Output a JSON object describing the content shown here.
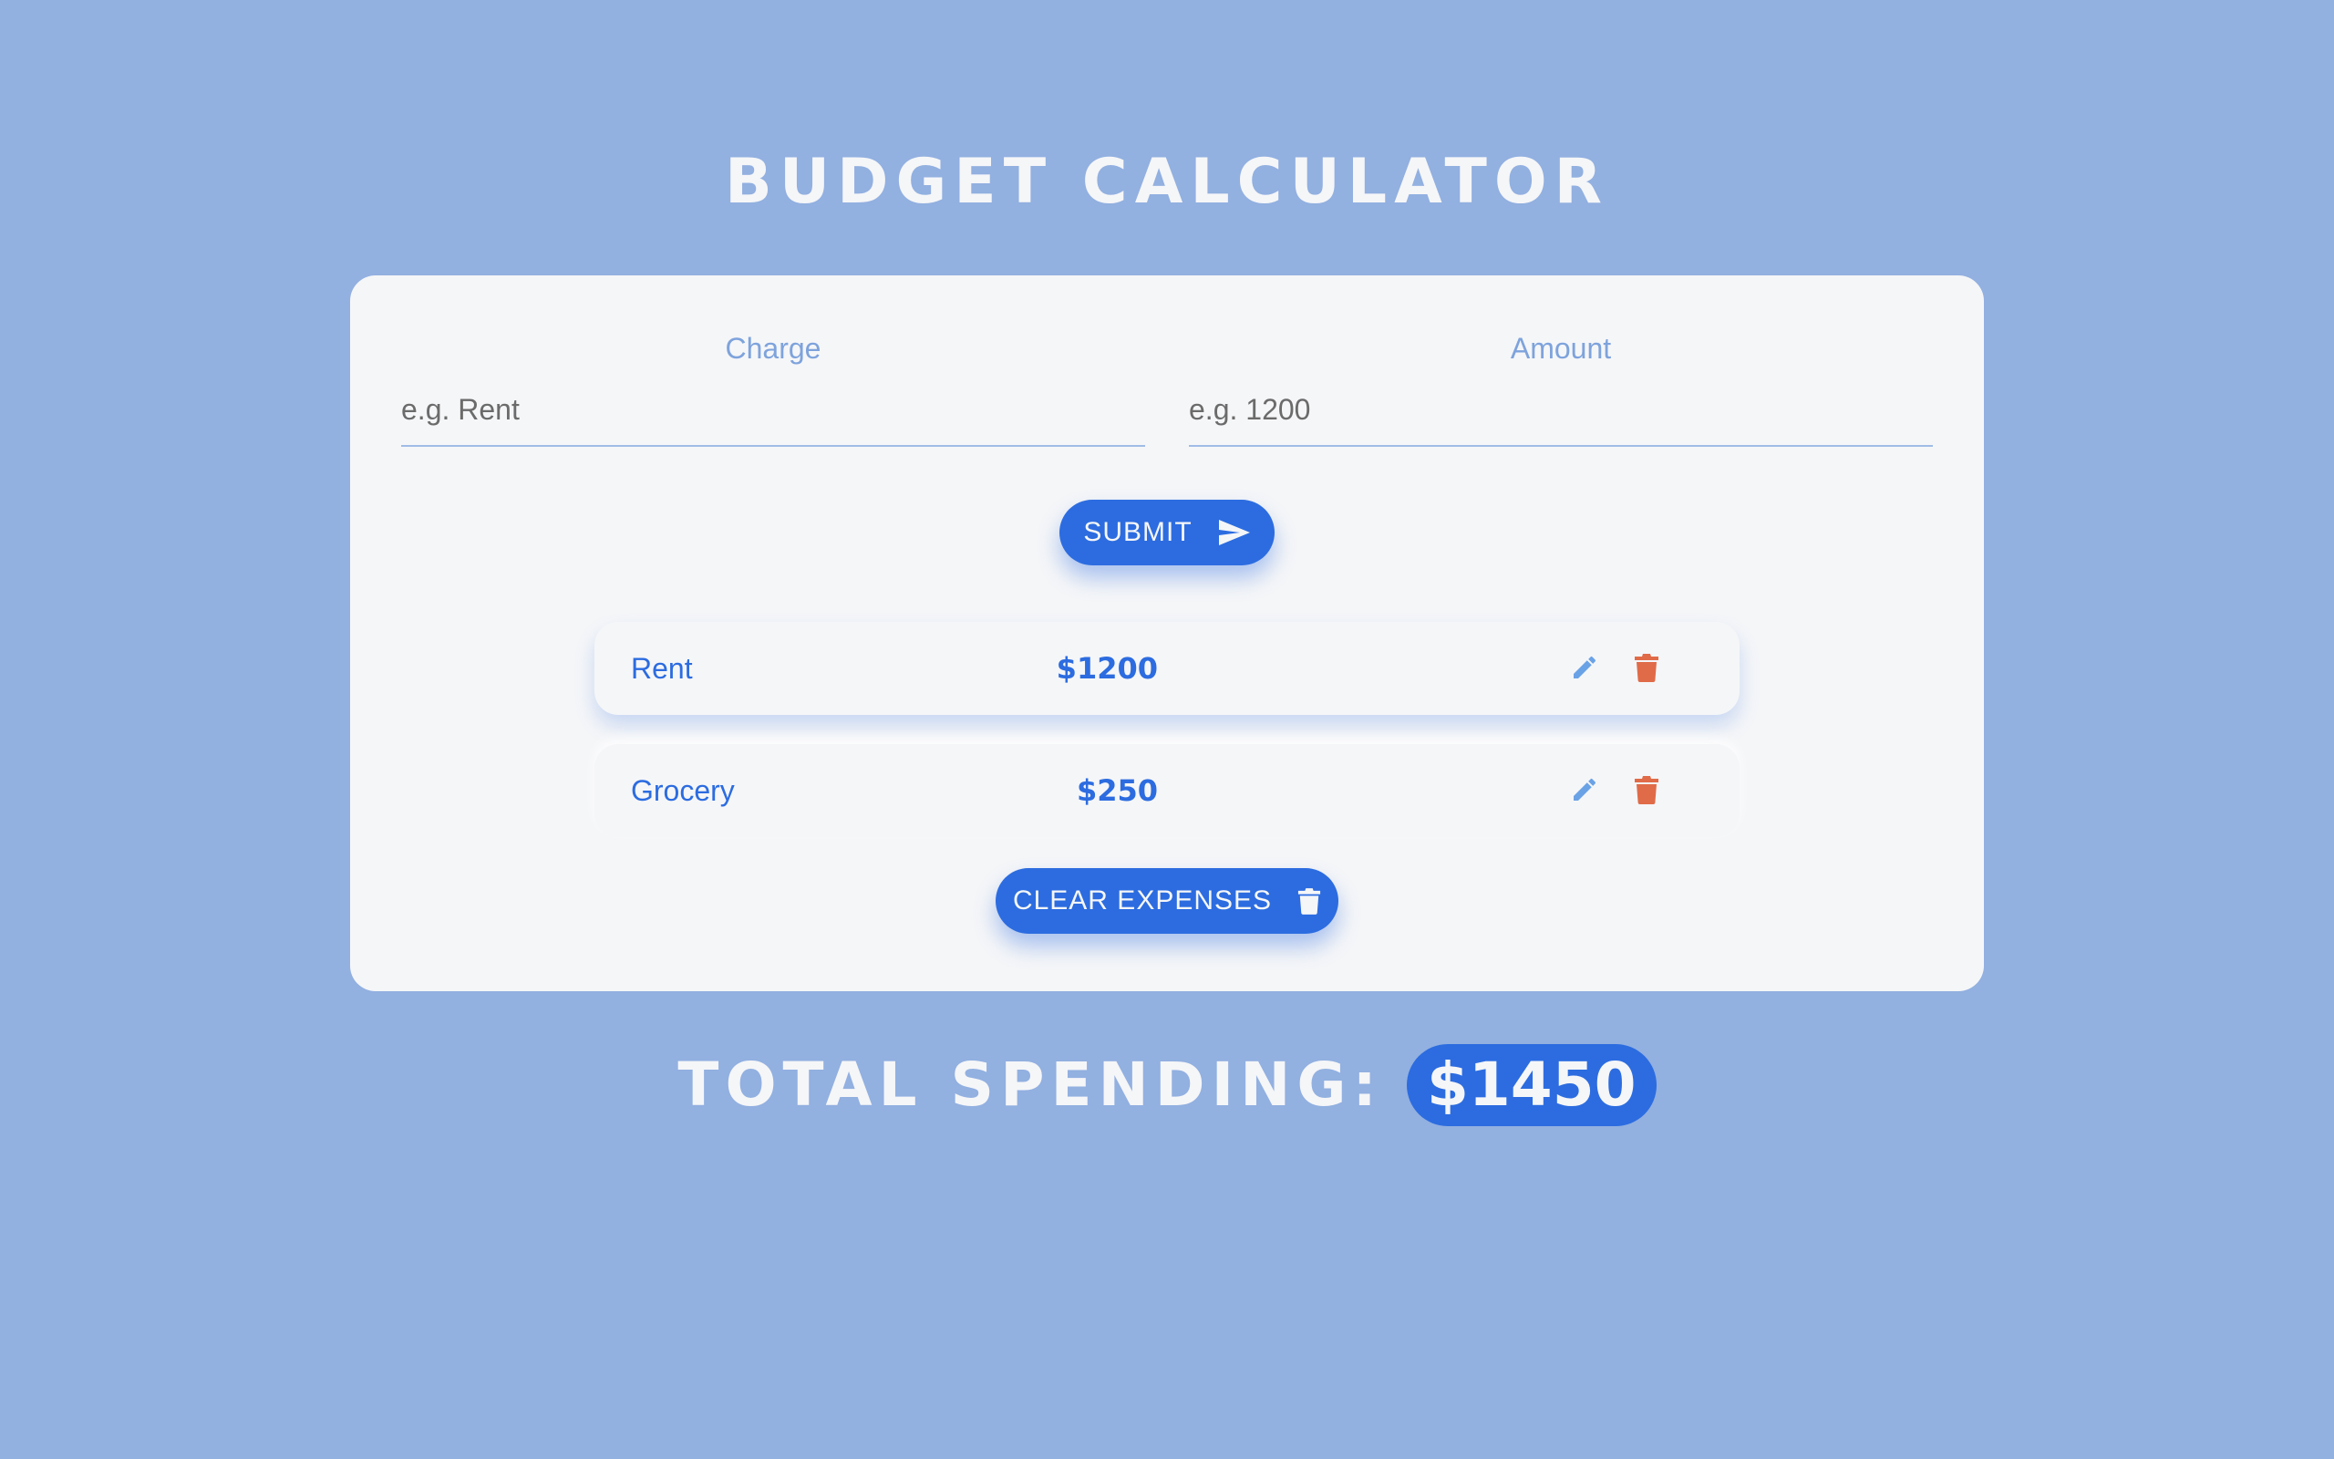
{
  "app": {
    "title": "BUDGET CALCULATOR"
  },
  "form": {
    "charge_label": "Charge",
    "charge_placeholder": "e.g. Rent",
    "charge_value": "",
    "amount_label": "Amount",
    "amount_placeholder": "e.g. 1200",
    "amount_value": "",
    "submit_label": "SUBMIT",
    "submit_icon": "send-icon"
  },
  "expenses": [
    {
      "name": "Rent",
      "amount": "$1200",
      "edit_icon": "pencil-icon",
      "delete_icon": "trash-icon"
    },
    {
      "name": "Grocery",
      "amount": "$250",
      "edit_icon": "pencil-icon",
      "delete_icon": "trash-icon"
    }
  ],
  "clear": {
    "label": "CLEAR EXPENSES",
    "icon": "trash-icon"
  },
  "total": {
    "label": "TOTAL SPENDING:",
    "value": "$1450"
  },
  "colors": {
    "background": "#92b0e0",
    "card": "#f5f6f8",
    "accent": "#2c6ce0",
    "edit_icon": "#6aa2e6",
    "delete_icon": "#e06b48"
  }
}
